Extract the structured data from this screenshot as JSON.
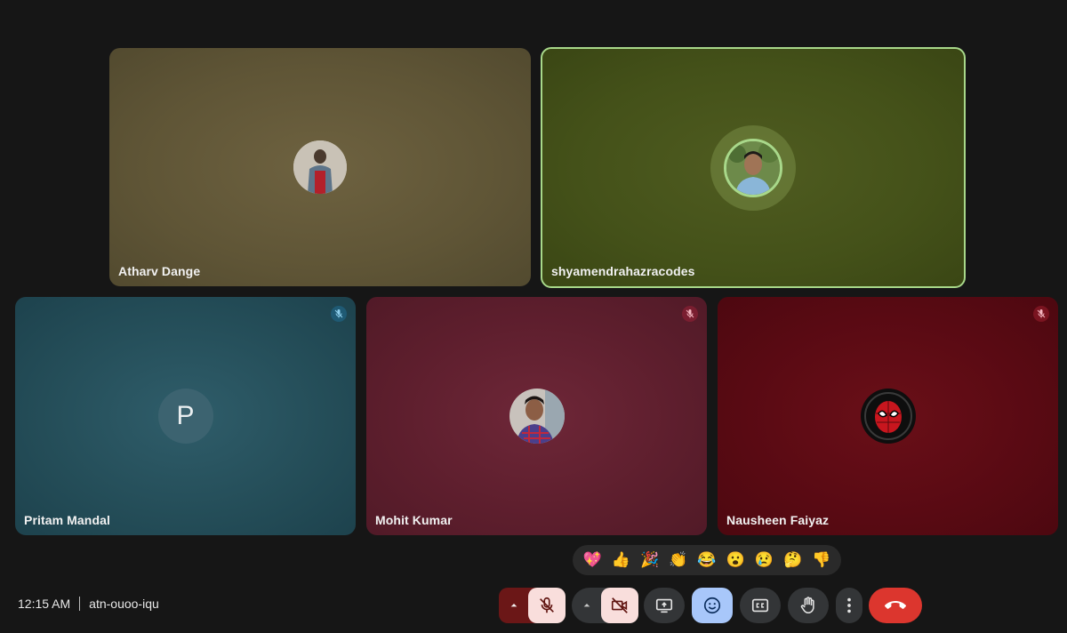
{
  "participants": {
    "atharv": {
      "name": "Atharv Dange"
    },
    "shyam": {
      "name": "shyamendrahazracodes"
    },
    "pritam": {
      "name": "Pritam Mandal",
      "initial": "P"
    },
    "mohit": {
      "name": "Mohit Kumar"
    },
    "nausheen": {
      "name": "Nausheen Faiyaz"
    }
  },
  "reactions": [
    "💖",
    "👍",
    "🎉",
    "👏",
    "😂",
    "😮",
    "😢",
    "🤔",
    "👎"
  ],
  "meeting": {
    "time": "12:15 AM",
    "code": "atn-ouoo-iqu"
  },
  "colors": {
    "active_speaker_border": "#a8d88a",
    "leave": "#dc362e",
    "muted_bg": "#f9dedc",
    "emoji_active": "#a8c7fa"
  }
}
